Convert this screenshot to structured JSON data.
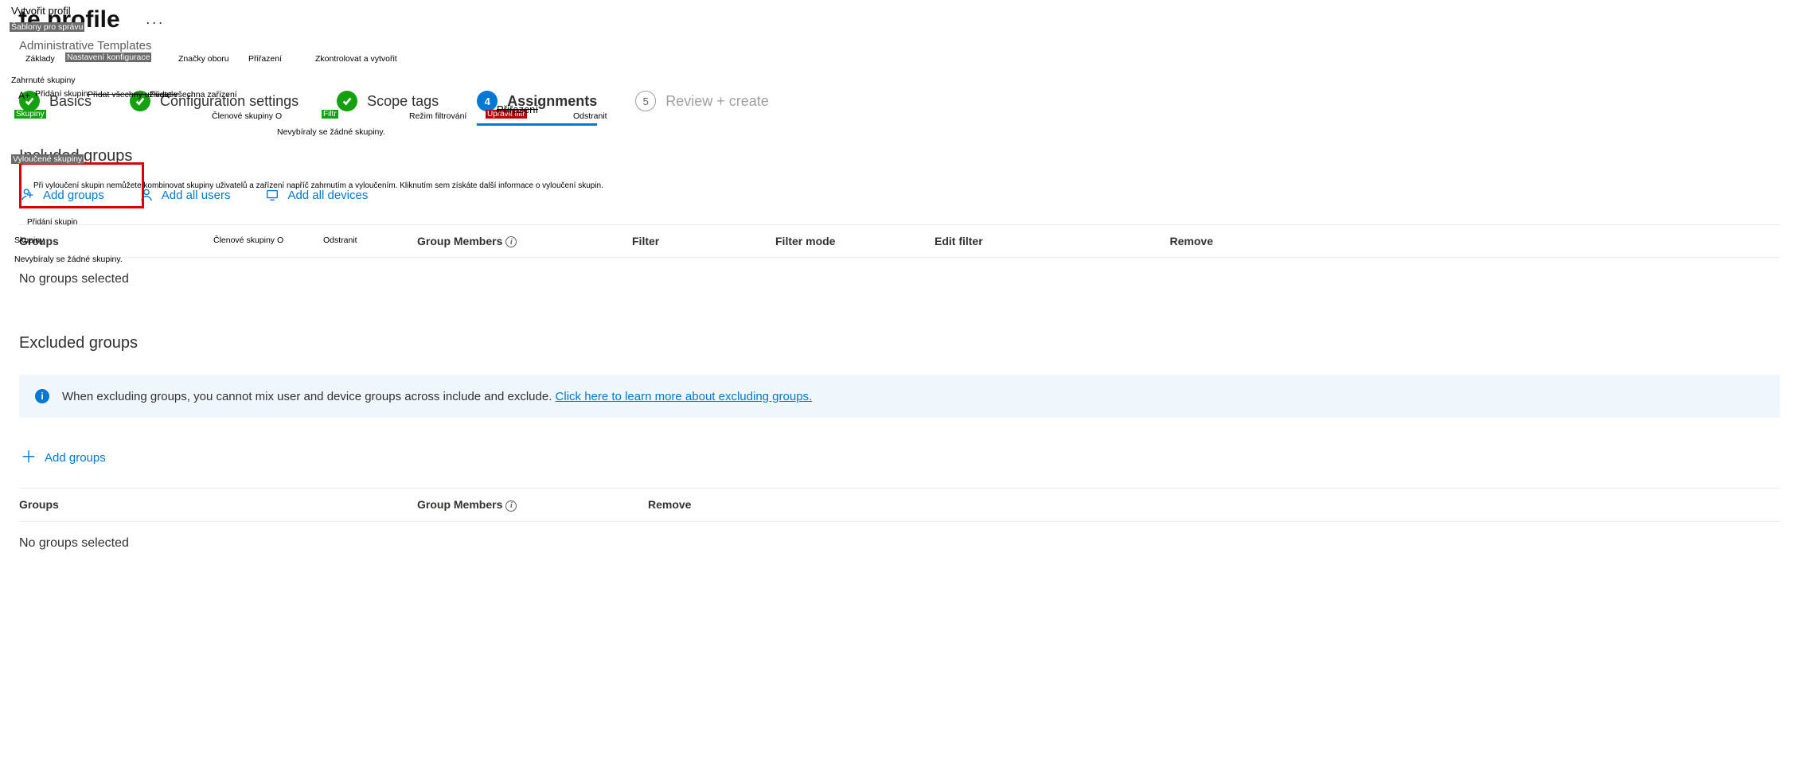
{
  "header": {
    "title_prefix_fragment": "te",
    "title": "te profile",
    "more_btn": "···",
    "subtitle": "Administrative Templates"
  },
  "stepper": {
    "basics": "Basics",
    "config": "Configuration settings",
    "scope": "Scope tags",
    "assign": "Assignments",
    "review": "Review + create",
    "step4_num": "4",
    "step5_num": "5"
  },
  "included": {
    "heading": "Included groups",
    "add_groups": "Add groups",
    "add_all_users": "Add all users",
    "add_all_devices": "Add all devices",
    "cols": {
      "groups": "Groups",
      "group_members": "Group Members",
      "filter": "Filter",
      "filter_mode": "Filter mode",
      "edit_filter": "Edit filter",
      "remove": "Remove"
    },
    "empty": "No groups selected"
  },
  "excluded": {
    "heading": "Excluded groups",
    "banner_text": "When excluding groups, you cannot mix user and device groups across include and exclude. ",
    "banner_link": "Click here to learn more about excluding groups.",
    "add_groups": "Add groups",
    "cols": {
      "groups": "Groups",
      "group_members": "Group Members",
      "remove": "Remove"
    },
    "empty": "No groups selected"
  },
  "overlay_cs": {
    "vytvorit_profil": "Vytvořit profil",
    "sablony": "Šablony pro správu",
    "tabs": {
      "zaklady": "Základy",
      "nastaveni": "Nastavení konfigurace",
      "znacky": "Značky oboru",
      "prirazeni": "Přiřazení",
      "zkontrolovat": "Zkontrolovat a vytvořit"
    },
    "zahrnute": "Zahrnuté skupiny",
    "aplus": "A+",
    "pridani_skupin": "Přidání skupin",
    "pridat_vsechny_uzivatele": "Přidat všechny uživatele",
    "pridat_vsechna_zarizeni": "Přidat všechna zařízení",
    "skupiny_green": "Skupiny",
    "clenove_skupiny_o": "Členové skupiny O",
    "filtr_green": "Filtr",
    "rezim": "Režim filtrování",
    "upravit_filtr": "Upravit filtr",
    "prirazeni_strike": "Přiřazení",
    "odstranit": "Odstranit",
    "nevybiraly": "Nevybíraly se žádné skupiny.",
    "vyloucene": "Vyloučené skupiny",
    "info_cs": "Při vyloučení skupin nemůžete kombinovat skupiny uživatelů a zařízení napříč zahrnutím a vyloučením. Kliknutím sem získáte další informace o vyloučení skupin.",
    "pridani_skupin2": "Přidání skupin",
    "skupiny2": "Skupiny",
    "clenove2": "Členové skupiny O",
    "odstranit2": "Odstranit",
    "nevybiraly2": "Nevybíraly se žádné skupiny."
  }
}
